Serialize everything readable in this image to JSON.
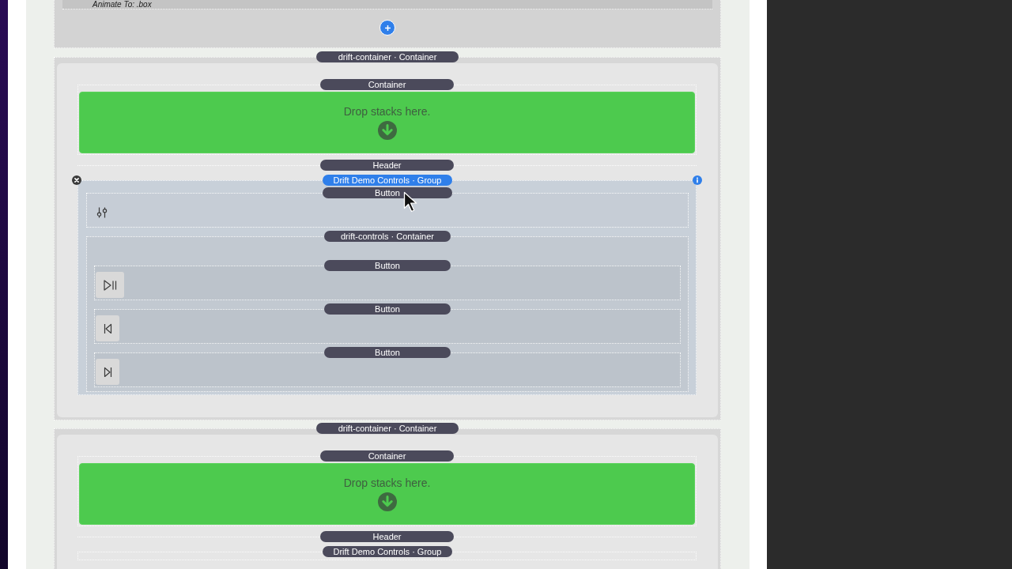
{
  "top_section": {
    "rows": [
      {
        "label": "Animate To: .box"
      }
    ]
  },
  "sections": [
    {
      "label": "drift-container · Container",
      "blocks": [
        {
          "kind": "container",
          "label": "Container",
          "drop_text": "Drop stacks here."
        },
        {
          "kind": "header",
          "label": "Header"
        },
        {
          "kind": "group",
          "label": "Drift Demo Controls · Group",
          "selected": true,
          "children": [
            {
              "kind": "button",
              "label": "Button"
            },
            {
              "kind": "container",
              "label": "drift-controls · Container",
              "children": [
                {
                  "kind": "button",
                  "label": "Button"
                },
                {
                  "kind": "button",
                  "label": "Button"
                },
                {
                  "kind": "button",
                  "label": "Button"
                }
              ]
            }
          ]
        }
      ]
    },
    {
      "label": "drift-container · Container",
      "blocks": [
        {
          "kind": "container",
          "label": "Container",
          "drop_text": "Drop stacks here."
        },
        {
          "kind": "header",
          "label": "Header"
        },
        {
          "kind": "group",
          "label": "Drift Demo Controls · Group",
          "selected": false
        }
      ]
    }
  ]
}
